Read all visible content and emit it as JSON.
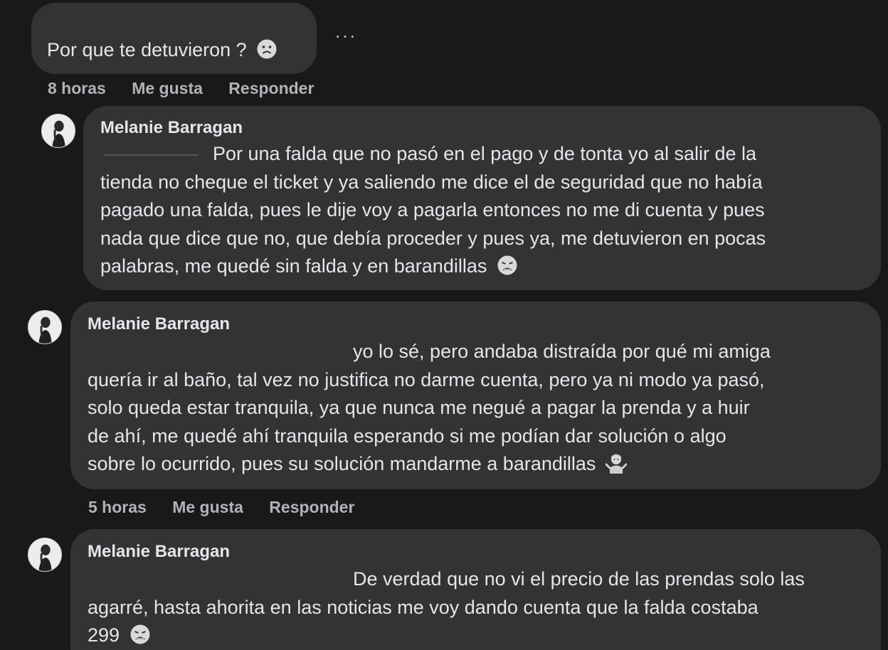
{
  "comment_top": {
    "text": "Por que te detuvieron ?",
    "emoji": "frowning-face-icon",
    "time": "8 horas",
    "like_label": "Me gusta",
    "reply_label": "Responder",
    "more_label": "···"
  },
  "reply1": {
    "author": "Melanie Barragan",
    "lines": [
      "Por una falda que no pasó en el pago y de tonta yo al salir de la",
      "tienda no cheque el ticket y ya saliendo me dice el de seguridad que no había",
      "pagado una falda, pues le dije voy a pagarla entonces no me di cuenta y pues",
      "nada que dice que no, que debía proceder y pues ya, me detuvieron en pocas",
      "palabras, me quedé sin falda y en barandillas"
    ],
    "emoji": "weary-face-icon"
  },
  "reply2": {
    "author": "Melanie Barragan",
    "lines": [
      "yo lo sé, pero andaba distraída por qué mi amiga",
      "quería ir al baño, tal vez no justifica no darme cuenta, pero ya ni modo ya pasó,",
      "solo queda estar tranquila, ya que nunca me negué a pagar la prenda y a huir",
      "de ahí, me quedé ahí tranquila esperando si me podían dar solución o algo",
      "sobre lo ocurrido, pues su solución mandarme a barandillas"
    ],
    "emoji": "person-shrugging-icon",
    "time": "5 horas",
    "like_label": "Me gusta",
    "reply_label": "Responder"
  },
  "reply3": {
    "author": "Melanie Barragan",
    "lines": [
      "De verdad que no vi el precio de las prendas solo las",
      "agarré, hasta ahorita en las noticias me voy dando cuenta que la falda costaba",
      "299"
    ],
    "emoji": "weary-face-icon"
  },
  "colors": {
    "background": "#19191a",
    "bubble": "#333334",
    "text": "#e4e6eb",
    "secondary": "#b0b3b8"
  }
}
